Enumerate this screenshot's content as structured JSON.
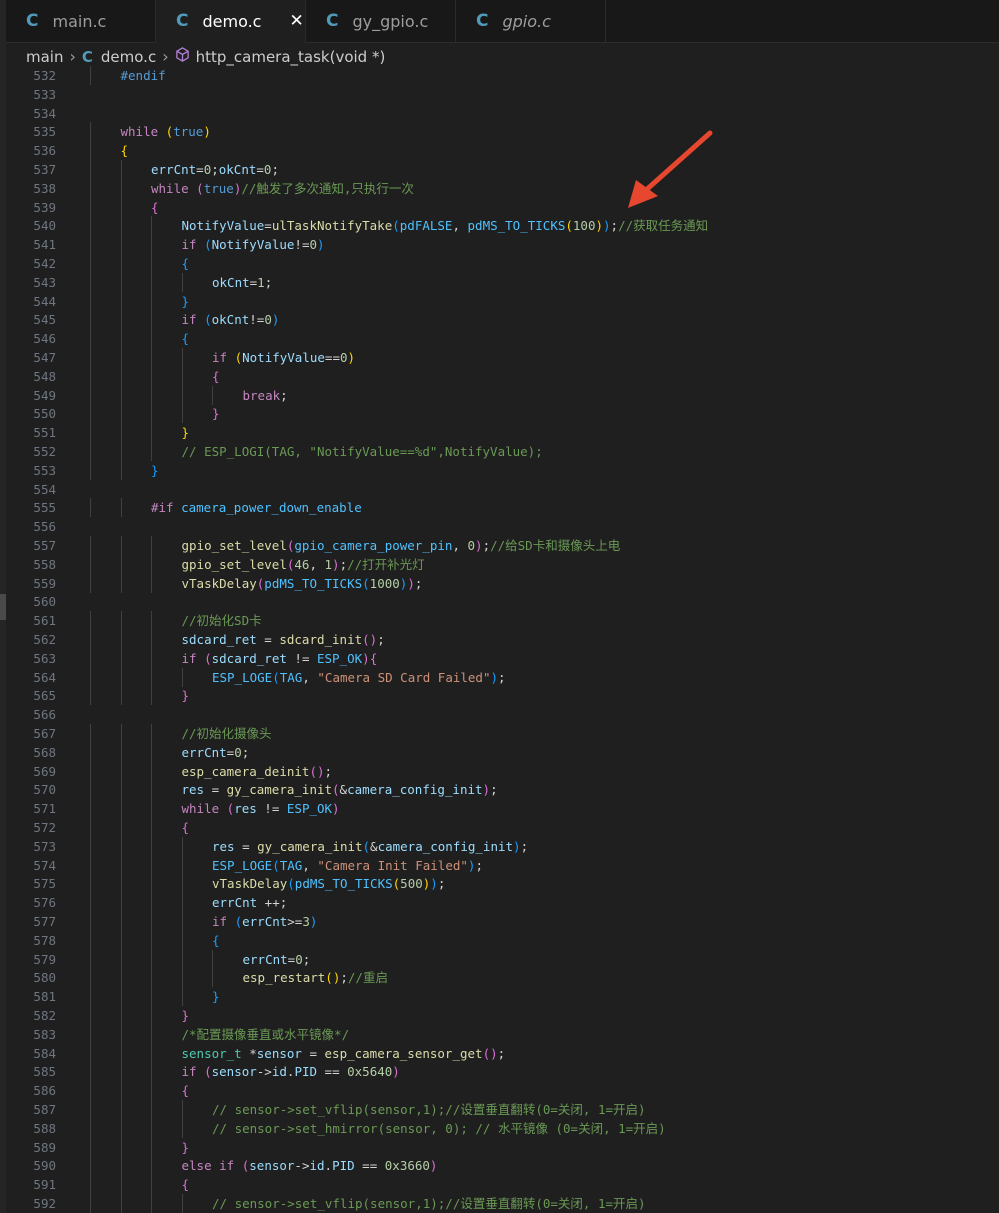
{
  "tabs": [
    {
      "label": "main.c",
      "active": false,
      "italic": false
    },
    {
      "label": "demo.c",
      "active": true,
      "italic": false
    },
    {
      "label": "gy_gpio.c",
      "active": false,
      "italic": false
    },
    {
      "label": "gpio.c",
      "active": false,
      "italic": true
    }
  ],
  "tab_icon_glyph": "C",
  "close_glyph": "✕",
  "breadcrumb": {
    "folder": "main",
    "file": "demo.c",
    "symbol": "http_camera_task(void *)"
  },
  "colors": {
    "accent_icon": "#519aba",
    "arrow": "#e8472f",
    "background": "#1f1f1f"
  },
  "lines": [
    {
      "n": "532",
      "i": 1,
      "t": [
        [
          "#endif",
          "kb"
        ]
      ]
    },
    {
      "n": "533",
      "i": 0,
      "t": []
    },
    {
      "n": "534",
      "i": 0,
      "t": []
    },
    {
      "n": "535",
      "i": 1,
      "t": [
        [
          "while",
          "kw"
        ],
        [
          " ",
          "tx"
        ],
        [
          "(",
          "p1"
        ],
        [
          "true",
          "kb"
        ],
        [
          ")",
          "p1"
        ]
      ]
    },
    {
      "n": "536",
      "i": 1,
      "t": [
        [
          "{",
          "p1"
        ]
      ]
    },
    {
      "n": "537",
      "i": 2,
      "t": [
        [
          "errCnt",
          "var"
        ],
        [
          "=",
          "tx"
        ],
        [
          "0",
          "num"
        ],
        [
          ";",
          "tx"
        ],
        [
          "okCnt",
          "var"
        ],
        [
          "=",
          "tx"
        ],
        [
          "0",
          "num"
        ],
        [
          ";",
          "tx"
        ]
      ]
    },
    {
      "n": "538",
      "i": 2,
      "t": [
        [
          "while",
          "kw"
        ],
        [
          " ",
          "tx"
        ],
        [
          "(",
          "p2"
        ],
        [
          "true",
          "kb"
        ],
        [
          ")",
          "p2"
        ],
        [
          "//触发了多次通知,只执行一次",
          "cm"
        ]
      ]
    },
    {
      "n": "539",
      "i": 2,
      "t": [
        [
          "{",
          "p2"
        ]
      ]
    },
    {
      "n": "540",
      "i": 3,
      "t": [
        [
          "NotifyValue",
          "var"
        ],
        [
          "=",
          "tx"
        ],
        [
          "ulTaskNotifyTake",
          "fn"
        ],
        [
          "(",
          "p3"
        ],
        [
          "pdFALSE",
          "mac"
        ],
        [
          ", ",
          "tx"
        ],
        [
          "pdMS_TO_TICKS",
          "mac"
        ],
        [
          "(",
          "p1"
        ],
        [
          "100",
          "num"
        ],
        [
          ")",
          "p1"
        ],
        [
          ")",
          "p3"
        ],
        [
          ";",
          "tx"
        ],
        [
          "//获取任务通知",
          "cm"
        ]
      ]
    },
    {
      "n": "541",
      "i": 3,
      "t": [
        [
          "if",
          "kw"
        ],
        [
          " ",
          "tx"
        ],
        [
          "(",
          "p3"
        ],
        [
          "NotifyValue",
          "var"
        ],
        [
          "!=",
          "tx"
        ],
        [
          "0",
          "num"
        ],
        [
          ")",
          "p3"
        ]
      ]
    },
    {
      "n": "542",
      "i": 3,
      "t": [
        [
          "{",
          "p3"
        ]
      ]
    },
    {
      "n": "543",
      "i": 4,
      "t": [
        [
          "okCnt",
          "var"
        ],
        [
          "=",
          "tx"
        ],
        [
          "1",
          "num"
        ],
        [
          ";",
          "tx"
        ]
      ]
    },
    {
      "n": "544",
      "i": 3,
      "t": [
        [
          "}",
          "p3"
        ]
      ]
    },
    {
      "n": "545",
      "i": 3,
      "t": [
        [
          "if",
          "kw"
        ],
        [
          " ",
          "tx"
        ],
        [
          "(",
          "p3"
        ],
        [
          "okCnt",
          "var"
        ],
        [
          "!=",
          "tx"
        ],
        [
          "0",
          "num"
        ],
        [
          ")",
          "p3"
        ]
      ]
    },
    {
      "n": "546",
      "i": 3,
      "t": [
        [
          "{",
          "p3"
        ]
      ]
    },
    {
      "n": "547",
      "i": 4,
      "t": [
        [
          "if",
          "kw"
        ],
        [
          " ",
          "tx"
        ],
        [
          "(",
          "p1"
        ],
        [
          "NotifyValue",
          "var"
        ],
        [
          "==",
          "tx"
        ],
        [
          "0",
          "num"
        ],
        [
          ")",
          "p1"
        ]
      ]
    },
    {
      "n": "548",
      "i": 4,
      "t": [
        [
          "{",
          "p2"
        ]
      ]
    },
    {
      "n": "549",
      "i": 5,
      "t": [
        [
          "break",
          "kw"
        ],
        [
          ";",
          "tx"
        ]
      ]
    },
    {
      "n": "550",
      "i": 4,
      "t": [
        [
          "}",
          "p2"
        ]
      ]
    },
    {
      "n": "551",
      "i": 3,
      "t": [
        [
          "}",
          "p1"
        ]
      ]
    },
    {
      "n": "552",
      "i": 3,
      "t": [
        [
          "// ESP_LOGI(TAG, \"NotifyValue==%d\",NotifyValue);",
          "cm"
        ]
      ]
    },
    {
      "n": "553",
      "i": 2,
      "t": [
        [
          "}",
          "p3"
        ]
      ]
    },
    {
      "n": "554",
      "i": 0,
      "t": []
    },
    {
      "n": "555",
      "i": 2,
      "t": [
        [
          "#if",
          "kw"
        ],
        [
          " ",
          "tx"
        ],
        [
          "camera_power_down_enable",
          "mac"
        ]
      ]
    },
    {
      "n": "556",
      "i": 0,
      "t": []
    },
    {
      "n": "557",
      "i": 3,
      "t": [
        [
          "gpio_set_level",
          "fn"
        ],
        [
          "(",
          "p2"
        ],
        [
          "gpio_camera_power_pin",
          "mac"
        ],
        [
          ", ",
          "tx"
        ],
        [
          "0",
          "num"
        ],
        [
          ")",
          "p2"
        ],
        [
          ";",
          "tx"
        ],
        [
          "//给SD卡和摄像头上电",
          "cm"
        ]
      ]
    },
    {
      "n": "558",
      "i": 3,
      "t": [
        [
          "gpio_set_level",
          "fn"
        ],
        [
          "(",
          "p2"
        ],
        [
          "46",
          "num"
        ],
        [
          ", ",
          "tx"
        ],
        [
          "1",
          "num"
        ],
        [
          ")",
          "p2"
        ],
        [
          ";",
          "tx"
        ],
        [
          "//打开补光灯",
          "cm"
        ]
      ]
    },
    {
      "n": "559",
      "i": 3,
      "t": [
        [
          "vTaskDelay",
          "fn"
        ],
        [
          "(",
          "p2"
        ],
        [
          "pdMS_TO_TICKS",
          "mac"
        ],
        [
          "(",
          "p3"
        ],
        [
          "1000",
          "num"
        ],
        [
          ")",
          "p3"
        ],
        [
          ")",
          "p2"
        ],
        [
          ";",
          "tx"
        ]
      ]
    },
    {
      "n": "560",
      "i": 0,
      "t": []
    },
    {
      "n": "561",
      "i": 3,
      "t": [
        [
          "//初始化SD卡",
          "cm"
        ]
      ]
    },
    {
      "n": "562",
      "i": 3,
      "t": [
        [
          "sdcard_ret",
          "var"
        ],
        [
          " = ",
          "tx"
        ],
        [
          "sdcard_init",
          "fn"
        ],
        [
          "()",
          "p2"
        ],
        [
          ";",
          "tx"
        ]
      ]
    },
    {
      "n": "563",
      "i": 3,
      "t": [
        [
          "if",
          "kw"
        ],
        [
          " ",
          "tx"
        ],
        [
          "(",
          "p2"
        ],
        [
          "sdcard_ret",
          "var"
        ],
        [
          " != ",
          "tx"
        ],
        [
          "ESP_OK",
          "mac"
        ],
        [
          ")",
          "p2"
        ],
        [
          "{",
          "p2"
        ]
      ]
    },
    {
      "n": "564",
      "i": 4,
      "t": [
        [
          "ESP_LOGE",
          "mac"
        ],
        [
          "(",
          "p3"
        ],
        [
          "TAG",
          "mac"
        ],
        [
          ", ",
          "tx"
        ],
        [
          "\"Camera SD Card Failed\"",
          "str"
        ],
        [
          ")",
          "p3"
        ],
        [
          ";",
          "tx"
        ]
      ]
    },
    {
      "n": "565",
      "i": 3,
      "t": [
        [
          "}",
          "p2"
        ]
      ]
    },
    {
      "n": "566",
      "i": 0,
      "t": []
    },
    {
      "n": "567",
      "i": 3,
      "t": [
        [
          "//初始化摄像头",
          "cm"
        ]
      ]
    },
    {
      "n": "568",
      "i": 3,
      "t": [
        [
          "errCnt",
          "var"
        ],
        [
          "=",
          "tx"
        ],
        [
          "0",
          "num"
        ],
        [
          ";",
          "tx"
        ]
      ]
    },
    {
      "n": "569",
      "i": 3,
      "t": [
        [
          "esp_camera_deinit",
          "fn"
        ],
        [
          "()",
          "p2"
        ],
        [
          ";",
          "tx"
        ]
      ]
    },
    {
      "n": "570",
      "i": 3,
      "t": [
        [
          "res",
          "var"
        ],
        [
          " = ",
          "tx"
        ],
        [
          "gy_camera_init",
          "fn"
        ],
        [
          "(",
          "p2"
        ],
        [
          "&",
          "tx"
        ],
        [
          "camera_config_init",
          "var"
        ],
        [
          ")",
          "p2"
        ],
        [
          ";",
          "tx"
        ]
      ]
    },
    {
      "n": "571",
      "i": 3,
      "t": [
        [
          "while",
          "kw"
        ],
        [
          " ",
          "tx"
        ],
        [
          "(",
          "p2"
        ],
        [
          "res",
          "var"
        ],
        [
          " != ",
          "tx"
        ],
        [
          "ESP_OK",
          "mac"
        ],
        [
          ")",
          "p2"
        ]
      ]
    },
    {
      "n": "572",
      "i": 3,
      "t": [
        [
          "{",
          "p2"
        ]
      ]
    },
    {
      "n": "573",
      "i": 4,
      "t": [
        [
          "res",
          "var"
        ],
        [
          " = ",
          "tx"
        ],
        [
          "gy_camera_init",
          "fn"
        ],
        [
          "(",
          "p3"
        ],
        [
          "&",
          "tx"
        ],
        [
          "camera_config_init",
          "var"
        ],
        [
          ")",
          "p3"
        ],
        [
          ";",
          "tx"
        ]
      ]
    },
    {
      "n": "574",
      "i": 4,
      "t": [
        [
          "ESP_LOGE",
          "mac"
        ],
        [
          "(",
          "p3"
        ],
        [
          "TAG",
          "mac"
        ],
        [
          ", ",
          "tx"
        ],
        [
          "\"Camera Init Failed\"",
          "str"
        ],
        [
          ")",
          "p3"
        ],
        [
          ";",
          "tx"
        ]
      ]
    },
    {
      "n": "575",
      "i": 4,
      "t": [
        [
          "vTaskDelay",
          "fn"
        ],
        [
          "(",
          "p3"
        ],
        [
          "pdMS_TO_TICKS",
          "mac"
        ],
        [
          "(",
          "p1"
        ],
        [
          "500",
          "num"
        ],
        [
          ")",
          "p1"
        ],
        [
          ")",
          "p3"
        ],
        [
          ";",
          "tx"
        ]
      ]
    },
    {
      "n": "576",
      "i": 4,
      "t": [
        [
          "errCnt",
          "var"
        ],
        [
          " ++;",
          "tx"
        ]
      ]
    },
    {
      "n": "577",
      "i": 4,
      "t": [
        [
          "if",
          "kw"
        ],
        [
          " ",
          "tx"
        ],
        [
          "(",
          "p3"
        ],
        [
          "errCnt",
          "var"
        ],
        [
          ">=",
          "tx"
        ],
        [
          "3",
          "num"
        ],
        [
          ")",
          "p3"
        ]
      ]
    },
    {
      "n": "578",
      "i": 4,
      "t": [
        [
          "{",
          "p3"
        ]
      ]
    },
    {
      "n": "579",
      "i": 5,
      "t": [
        [
          "errCnt",
          "var"
        ],
        [
          "=",
          "tx"
        ],
        [
          "0",
          "num"
        ],
        [
          ";",
          "tx"
        ]
      ]
    },
    {
      "n": "580",
      "i": 5,
      "t": [
        [
          "esp_restart",
          "fn"
        ],
        [
          "()",
          "p1"
        ],
        [
          ";",
          "tx"
        ],
        [
          "//重启",
          "cm"
        ]
      ]
    },
    {
      "n": "581",
      "i": 4,
      "t": [
        [
          "}",
          "p3"
        ]
      ]
    },
    {
      "n": "582",
      "i": 3,
      "t": [
        [
          "}",
          "p2"
        ]
      ]
    },
    {
      "n": "583",
      "i": 3,
      "t": [
        [
          "/*配置摄像垂直或水平镜像*/",
          "cm"
        ]
      ]
    },
    {
      "n": "584",
      "i": 3,
      "t": [
        [
          "sensor_t",
          "ty"
        ],
        [
          " *",
          "tx"
        ],
        [
          "sensor",
          "var"
        ],
        [
          " = ",
          "tx"
        ],
        [
          "esp_camera_sensor_get",
          "fn"
        ],
        [
          "()",
          "p2"
        ],
        [
          ";",
          "tx"
        ]
      ]
    },
    {
      "n": "585",
      "i": 3,
      "t": [
        [
          "if",
          "kw"
        ],
        [
          " ",
          "tx"
        ],
        [
          "(",
          "p2"
        ],
        [
          "sensor",
          "var"
        ],
        [
          "->",
          "tx"
        ],
        [
          "id",
          "var"
        ],
        [
          ".",
          "tx"
        ],
        [
          "PID",
          "var"
        ],
        [
          " == ",
          "tx"
        ],
        [
          "0x5640",
          "num"
        ],
        [
          ")",
          "p2"
        ]
      ]
    },
    {
      "n": "586",
      "i": 3,
      "t": [
        [
          "{",
          "p2"
        ]
      ]
    },
    {
      "n": "587",
      "i": 4,
      "t": [
        [
          "// sensor->set_vflip(sensor,1);//设置垂直翻转(0=关闭, 1=开启)",
          "cm"
        ]
      ]
    },
    {
      "n": "588",
      "i": 4,
      "t": [
        [
          "// sensor->set_hmirror(sensor, 0); // 水平镜像 (0=关闭, 1=开启)",
          "cm"
        ]
      ]
    },
    {
      "n": "589",
      "i": 3,
      "t": [
        [
          "}",
          "p2"
        ]
      ]
    },
    {
      "n": "590",
      "i": 3,
      "t": [
        [
          "else",
          "kw"
        ],
        [
          " ",
          "tx"
        ],
        [
          "if",
          "kw"
        ],
        [
          " ",
          "tx"
        ],
        [
          "(",
          "p2"
        ],
        [
          "sensor",
          "var"
        ],
        [
          "->",
          "tx"
        ],
        [
          "id",
          "var"
        ],
        [
          ".",
          "tx"
        ],
        [
          "PID",
          "var"
        ],
        [
          " == ",
          "tx"
        ],
        [
          "0x3660",
          "num"
        ],
        [
          ")",
          "p2"
        ]
      ]
    },
    {
      "n": "591",
      "i": 3,
      "t": [
        [
          "{",
          "p2"
        ]
      ]
    },
    {
      "n": "592",
      "i": 4,
      "t": [
        [
          "// sensor->set_vflip(sensor,1);//设置垂直翻转(0=关闭, 1=开启)",
          "cm"
        ]
      ]
    }
  ]
}
